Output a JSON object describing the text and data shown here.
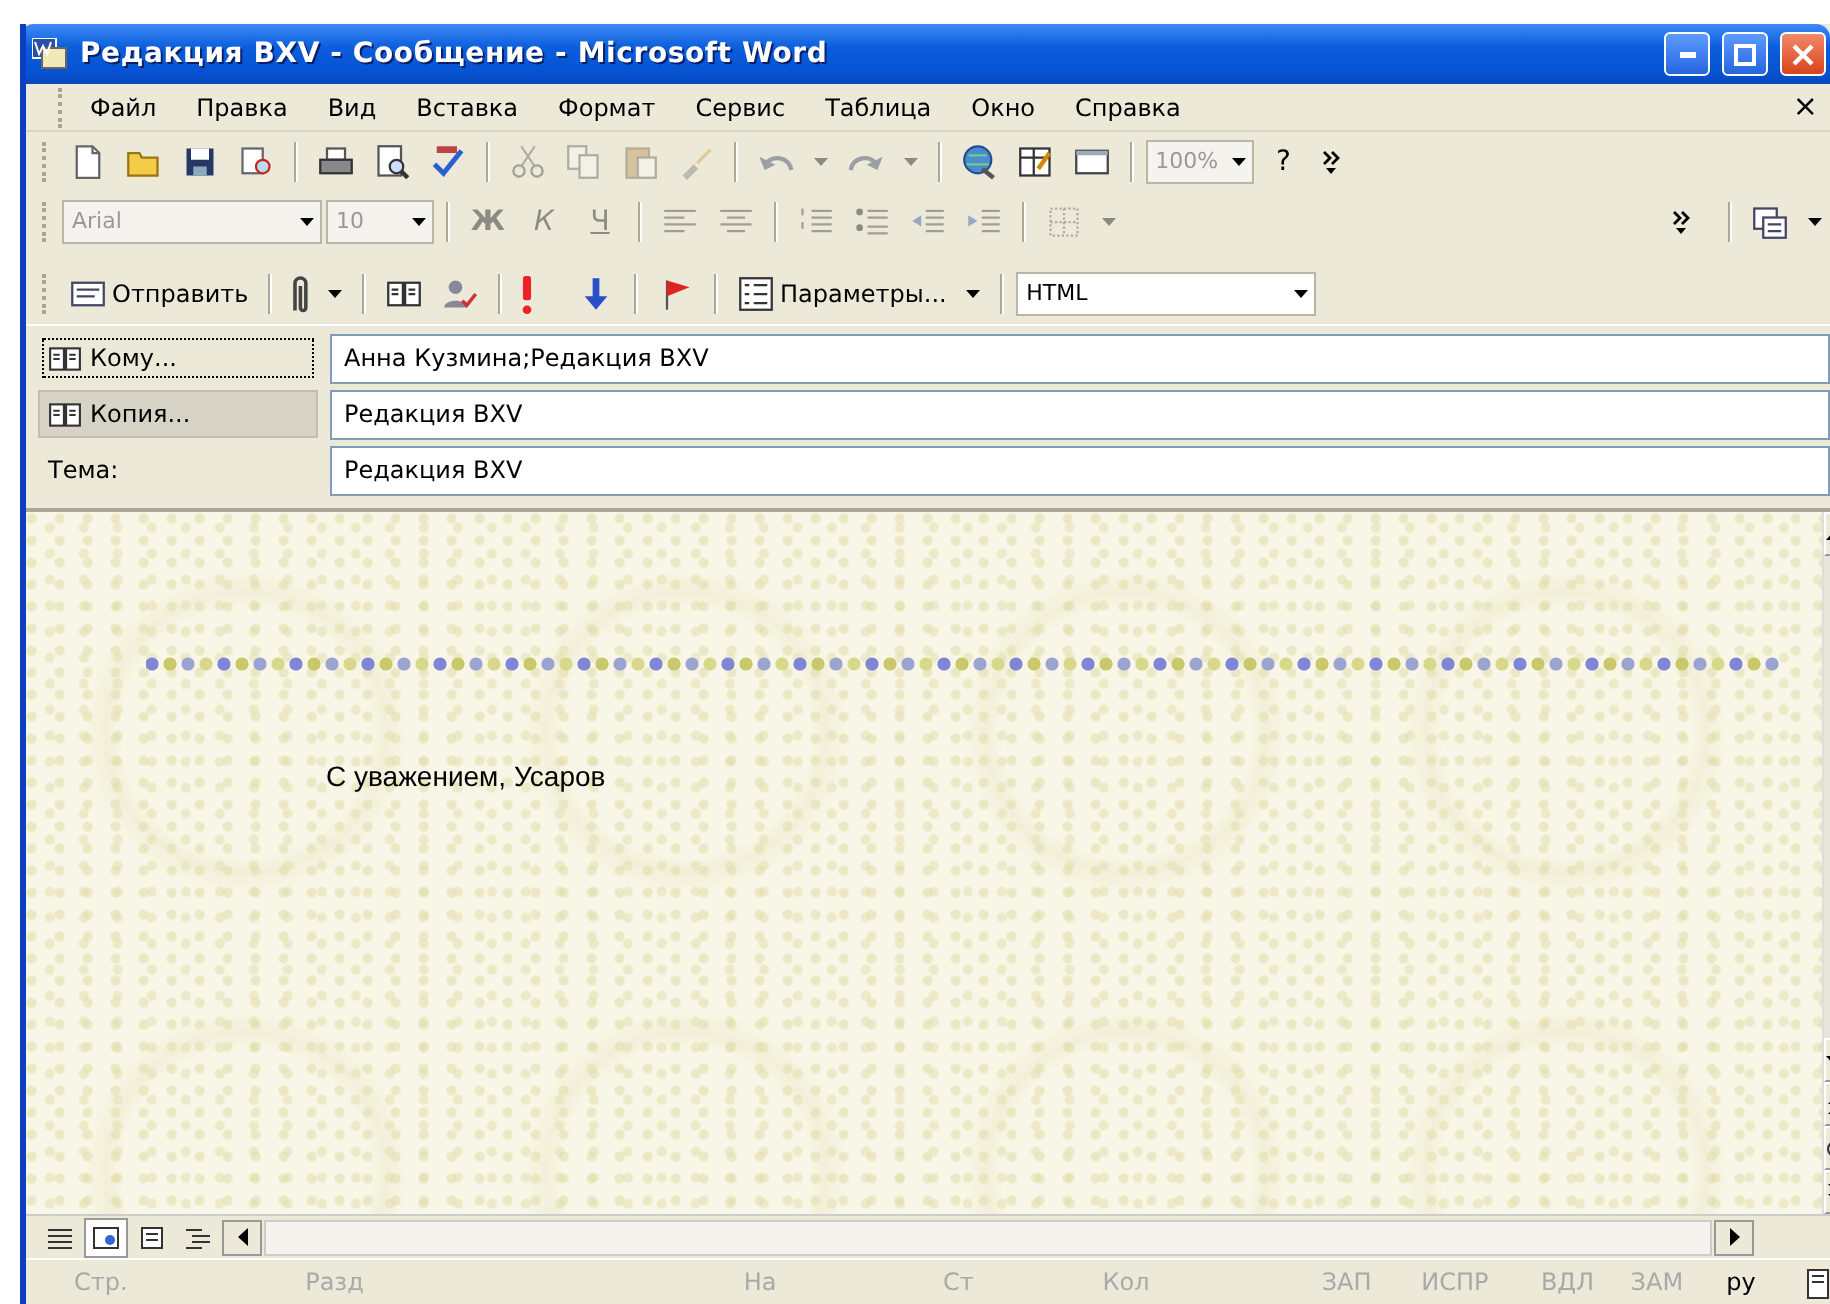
{
  "window": {
    "title": "Редакция BXV - Сообщение - Microsoft Word"
  },
  "menu": [
    {
      "label": "Файл"
    },
    {
      "label": "Правка"
    },
    {
      "label": "Вид"
    },
    {
      "label": "Вставка"
    },
    {
      "label": "Формат"
    },
    {
      "label": "Сервис"
    },
    {
      "label": "Таблица"
    },
    {
      "label": "Окно"
    },
    {
      "label": "Справка"
    }
  ],
  "menu_close": "×",
  "standard_toolbar": [
    {
      "kind": "button",
      "disabled": false
    },
    {
      "kind": "button",
      "disabled": false
    },
    {
      "kind": "button",
      "disabled": false
    },
    {
      "kind": "button",
      "disabled": false
    },
    {
      "kind": "separator"
    },
    {
      "kind": "button",
      "disabled": false
    },
    {
      "kind": "button",
      "disabled": false
    },
    {
      "kind": "button",
      "disabled": false
    },
    {
      "kind": "separator"
    },
    {
      "kind": "button",
      "disabled": true
    },
    {
      "kind": "button",
      "disabled": true
    },
    {
      "kind": "button",
      "disabled": true
    },
    {
      "kind": "button",
      "disabled": true
    },
    {
      "kind": "separator"
    },
    {
      "kind": "split",
      "disabled": true
    },
    {
      "kind": "split",
      "disabled": true
    },
    {
      "kind": "separator"
    },
    {
      "kind": "button",
      "disabled": false
    },
    {
      "kind": "button",
      "disabled": false
    },
    {
      "kind": "button",
      "disabled": false
    },
    {
      "kind": "separator"
    },
    {
      "kind": "combo",
      "text": "100%",
      "disabled": true
    },
    {
      "kind": "textbutton",
      "text": "?",
      "disabled": false
    },
    {
      "kind": "overflow"
    }
  ],
  "formatting_toolbar": [
    {
      "kind": "combo",
      "text": "Arial",
      "disabled": true
    },
    {
      "kind": "combo",
      "text": "10",
      "disabled": true
    },
    {
      "kind": "separator"
    },
    {
      "kind": "textbutton",
      "text": "Ж",
      "disabled": true
    },
    {
      "kind": "textbutton",
      "text": "К",
      "disabled": true
    },
    {
      "kind": "textbutton",
      "text": "Ч",
      "disabled": true
    },
    {
      "kind": "separator"
    },
    {
      "kind": "button",
      "disabled": true
    },
    {
      "kind": "button",
      "disabled": true
    },
    {
      "kind": "separator"
    },
    {
      "kind": "button",
      "disabled": true
    },
    {
      "kind": "button",
      "disabled": true
    },
    {
      "kind": "button",
      "disabled": true
    },
    {
      "kind": "button",
      "disabled": true
    },
    {
      "kind": "separator"
    },
    {
      "kind": "split",
      "disabled": true
    },
    {
      "kind": "spacer"
    },
    {
      "kind": "overflow"
    },
    {
      "kind": "separator"
    },
    {
      "kind": "split",
      "disabled": false
    }
  ],
  "message_toolbar": [
    {
      "kind": "labeled",
      "text": "Отправить",
      "disabled": false
    },
    {
      "kind": "separator"
    },
    {
      "kind": "split",
      "disabled": false
    },
    {
      "kind": "separator"
    },
    {
      "kind": "button",
      "disabled": false
    },
    {
      "kind": "button",
      "disabled": false
    },
    {
      "kind": "separator"
    },
    {
      "kind": "button",
      "disabled": false
    },
    {
      "kind": "button",
      "disabled": false
    },
    {
      "kind": "separator"
    },
    {
      "kind": "button",
      "disabled": false
    },
    {
      "kind": "separator"
    },
    {
      "kind": "labeled-split",
      "text": "Параметры...",
      "disabled": false
    },
    {
      "kind": "separator"
    },
    {
      "kind": "combo",
      "text": "HTML",
      "disabled": false
    }
  ],
  "fields": [
    {
      "kind": "button",
      "label": "Кому...",
      "focused": true,
      "hovered": false,
      "value": "Анна Кузмина;Редакция BXV"
    },
    {
      "kind": "button",
      "label": "Копия...",
      "focused": false,
      "hovered": true,
      "value": "Редакция BXV"
    },
    {
      "kind": "label",
      "label": "Тема:",
      "value": "Редакция BXV"
    }
  ],
  "body": {
    "text": "С уважением, Усаров"
  },
  "view_buttons": [
    {
      "selected": false
    },
    {
      "selected": true
    },
    {
      "selected": false
    },
    {
      "selected": false
    }
  ],
  "status_bar": [
    {
      "text": "Стр.",
      "disabled": true
    },
    {
      "text": "Разд",
      "disabled": true
    },
    {
      "text": "На",
      "disabled": true
    },
    {
      "text": "Ст",
      "disabled": true
    },
    {
      "text": "Кол",
      "disabled": true
    },
    {
      "text": "ЗАП",
      "disabled": true
    },
    {
      "text": "ИСПР",
      "disabled": true
    },
    {
      "text": "ВДЛ",
      "disabled": true
    },
    {
      "text": "ЗАМ",
      "disabled": true
    },
    {
      "text": "ру",
      "disabled": false
    }
  ]
}
